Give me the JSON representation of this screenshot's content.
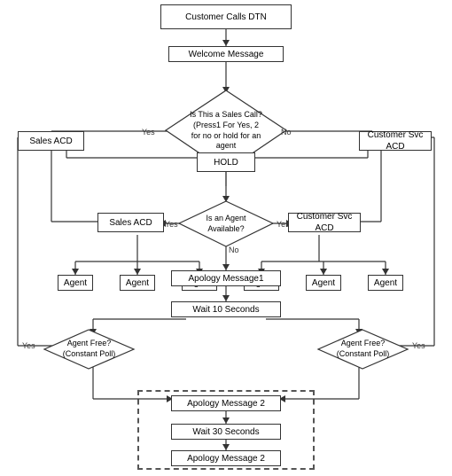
{
  "nodes": {
    "customer_calls": {
      "label": "Customer Calls DTN"
    },
    "welcome_msg": {
      "label": "Welcome Message"
    },
    "sales_call_q": {
      "label": "Is This a Sales Call?(Press1 For Yes, 2 for no or hold for an agent"
    },
    "hold": {
      "label": "HOLD"
    },
    "sales_acd_top": {
      "label": "Sales ACD"
    },
    "cust_svc_acd_top": {
      "label": "Customer Svc ACD"
    },
    "agent_avail_q": {
      "label": "Is an Agent Available?"
    },
    "sales_acd_mid": {
      "label": "Sales ACD"
    },
    "cust_svc_acd_mid": {
      "label": "Customer Svc ACD"
    },
    "agent1a": {
      "label": "Agent"
    },
    "agent1b": {
      "label": "Agent"
    },
    "agent1c": {
      "label": "Agent"
    },
    "agent2a": {
      "label": "Agent"
    },
    "agent2b": {
      "label": "Agent"
    },
    "agent2c": {
      "label": "Agent"
    },
    "apology1": {
      "label": "Apology Message1"
    },
    "wait_10": {
      "label": "Wait 10 Seconds"
    },
    "agent_free_left": {
      "label": "Agent Free?\n(Constant Poll)"
    },
    "agent_free_right": {
      "label": "Agent Free?\n(Constant Poll)"
    },
    "apology2a": {
      "label": "Apology Message 2"
    },
    "wait_30": {
      "label": "Wait 30 Seconds"
    },
    "apology2b": {
      "label": "Apology Message 2"
    }
  },
  "labels": {
    "yes_left": "Yes",
    "no_right": "No",
    "yes_agent_left": "Yes",
    "yes_agent_right": "Yes",
    "no_agent": "No",
    "yes_free_left": "Yes",
    "yes_free_right": "Yes"
  }
}
